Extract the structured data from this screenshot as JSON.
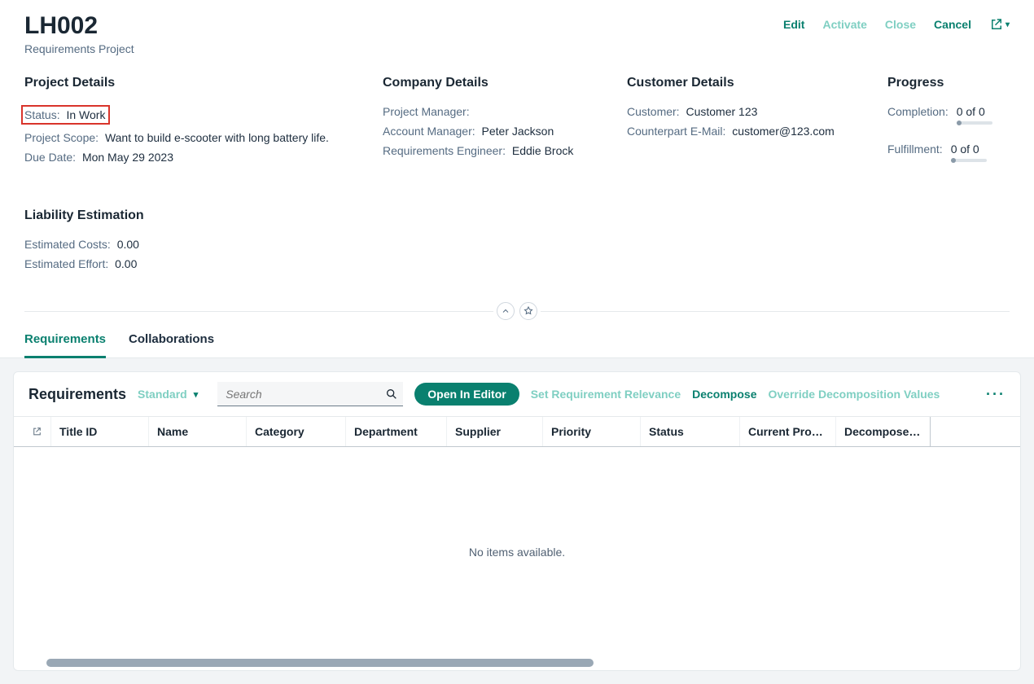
{
  "header": {
    "title": "LH002",
    "subtitle": "Requirements Project",
    "actions": {
      "edit": "Edit",
      "activate": "Activate",
      "close": "Close",
      "cancel": "Cancel"
    }
  },
  "projectDetails": {
    "title": "Project Details",
    "status_label": "Status:",
    "status_value": "In Work",
    "scope_label": "Project Scope:",
    "scope_value": "Want to build e-scooter with long battery life.",
    "due_label": "Due Date:",
    "due_value": "Mon May 29 2023"
  },
  "companyDetails": {
    "title": "Company Details",
    "pm_label": "Project Manager:",
    "pm_value": "",
    "am_label": "Account Manager:",
    "am_value": "Peter Jackson",
    "re_label": "Requirements Engineer:",
    "re_value": "Eddie Brock"
  },
  "customerDetails": {
    "title": "Customer Details",
    "cust_label": "Customer:",
    "cust_value": "Customer 123",
    "email_label": "Counterpart E-Mail:",
    "email_value": "customer@123.com"
  },
  "progress": {
    "title": "Progress",
    "completion_label": "Completion:",
    "completion_value": "0 of 0",
    "fulfillment_label": "Fulfillment:",
    "fulfillment_value": "0 of 0"
  },
  "liability": {
    "title": "Liability Estimation",
    "costs_label": "Estimated Costs:",
    "costs_value": "0.00",
    "effort_label": "Estimated Effort:",
    "effort_value": "0.00"
  },
  "tabs": {
    "requirements": "Requirements",
    "collaborations": "Collaborations"
  },
  "panel": {
    "title": "Requirements",
    "view": "Standard",
    "search_placeholder": "Search",
    "open_editor": "Open In Editor",
    "set_relevance": "Set Requirement Relevance",
    "decompose": "Decompose",
    "override": "Override Decomposition Values",
    "columns": {
      "title_id": "Title ID",
      "name": "Name",
      "category": "Category",
      "department": "Department",
      "supplier": "Supplier",
      "priority": "Priority",
      "status": "Status",
      "current_proc": "Current Proce…",
      "decomposer": "Decomposer …"
    },
    "empty": "No items available."
  }
}
